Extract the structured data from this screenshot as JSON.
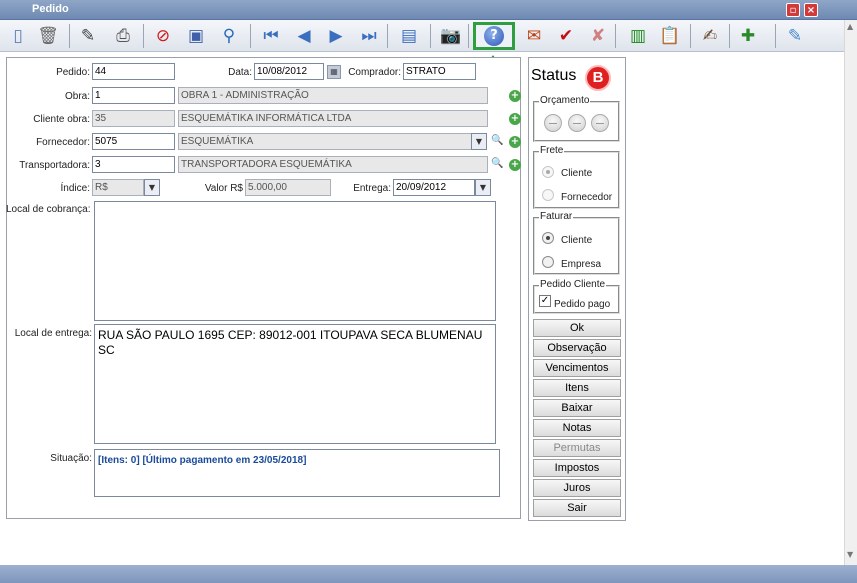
{
  "window": {
    "title": "Pedido"
  },
  "toolbar": {
    "items": [
      {
        "name": "new-document-icon",
        "glyph": "▯",
        "color": "#5b7fb8"
      },
      {
        "name": "trash-icon",
        "glyph": "🗑",
        "color": "#666"
      },
      {
        "name": "edit-icon",
        "glyph": "✎",
        "color": "#444"
      },
      {
        "name": "printer-icon",
        "glyph": "⎙",
        "color": "#555"
      },
      {
        "name": "cancel-icon",
        "glyph": "⊘",
        "color": "#d01818"
      },
      {
        "name": "save-icon",
        "glyph": "▣",
        "color": "#3f5fa8"
      },
      {
        "name": "search-icon",
        "glyph": "⚲",
        "color": "#2a6cb8"
      },
      {
        "name": "first-record-icon",
        "glyph": "⏮",
        "color": "#3a6fc0"
      },
      {
        "name": "previous-record-icon",
        "glyph": "◀",
        "color": "#3a6fc0"
      },
      {
        "name": "next-record-icon",
        "glyph": "▶",
        "color": "#3a6fc0"
      },
      {
        "name": "last-record-icon",
        "glyph": "⏭",
        "color": "#3a6fc0"
      },
      {
        "name": "preview-icon",
        "glyph": "▤",
        "color": "#3a6fc0"
      },
      {
        "name": "camera-icon",
        "glyph": "📷",
        "color": "#222"
      },
      {
        "name": "help-icon",
        "glyph": "?",
        "color": "#fff"
      },
      {
        "name": "approve-icon",
        "glyph": "✉",
        "color": "#c04010"
      },
      {
        "name": "approve-check-icon",
        "glyph": "✔",
        "color": "#c01010"
      },
      {
        "name": "reject-icon",
        "glyph": "✘",
        "color": "#d08080"
      },
      {
        "name": "barcode-icon",
        "glyph": "▥",
        "color": "#1a8a1a"
      },
      {
        "name": "clipboard-icon",
        "glyph": "📋",
        "color": "#8a5a2a"
      },
      {
        "name": "sign-icon",
        "glyph": "✍",
        "color": "#6a4a2a"
      },
      {
        "name": "add-item-icon",
        "glyph": "✚",
        "color": "#2a8a2a"
      },
      {
        "name": "tools-icon",
        "glyph": "✎",
        "color": "#4a8ac8"
      }
    ],
    "highlight_color": "#2e9e3e"
  },
  "form": {
    "pedido_label": "Pedido:",
    "pedido": "44",
    "data_label": "Data:",
    "data": "10/08/2012",
    "comprador_label": "Comprador:",
    "comprador": "STRATO",
    "obra_label": "Obra:",
    "obra_code": "1",
    "obra_name": "OBRA 1 - ADMINISTRAÇÃO",
    "cliente_obra_label": "Cliente obra:",
    "cliente_obra_code": "35",
    "cliente_obra_name": "ESQUEMÁTIKA INFORMÁTICA LTDA",
    "fornecedor_label": "Fornecedor:",
    "fornecedor_code": "5075",
    "fornecedor_name": "ESQUEMÁTIKA",
    "transportadora_label": "Transportadora:",
    "transportadora_code": "3",
    "transportadora_name": "TRANSPORTADORA ESQUEMÁTIKA",
    "indice_label": "Índice:",
    "indice": "R$",
    "valor_label": "Valor R$",
    "valor": "5.000,00",
    "entrega_label": "Entrega:",
    "entrega": "20/09/2012",
    "local_cobranca_label": "Local de cobrança:",
    "local_cobranca": "",
    "local_entrega_label": "Local de entrega:",
    "local_entrega": "RUA SÃO PAULO 1695 CEP: 89012-001 ITOUPAVA SECA BLUMENAU SC",
    "situacao_label": "Situação:",
    "situacao": "[Itens: 0] [Último pagamento em 23/05/2018]"
  },
  "status": {
    "title": "Status",
    "badge": "B",
    "badge_color": "#e02020",
    "orcamento_label": "Orçamento",
    "frete_label": "Frete",
    "frete_options": [
      "Cliente",
      "Fornecedor"
    ],
    "faturar_label": "Faturar",
    "faturar_options": [
      "Cliente",
      "Empresa"
    ],
    "pedido_cliente_label": "Pedido Cliente",
    "pedido_pago_label": "Pedido pago",
    "pedido_pago": true
  },
  "buttons": [
    "Ok",
    "Observação",
    "Vencimentos",
    "Itens",
    "Baixar",
    "Notas",
    "Permutas",
    "Impostos",
    "Juros",
    "Sair"
  ],
  "disabled_buttons": [
    "Permutas"
  ]
}
